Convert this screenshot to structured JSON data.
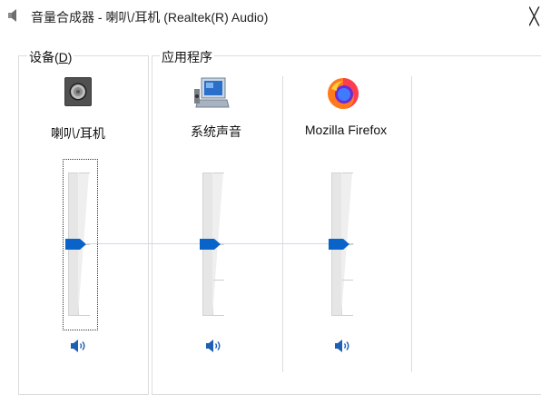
{
  "window": {
    "title": "音量合成器 - 喇叭/耳机 (Realtek(R) Audio)",
    "close_glyph": "╳"
  },
  "device_group": {
    "label_prefix": "设备(",
    "label_access_key": "D",
    "label_suffix": ")",
    "device_name": "喇叭/耳机",
    "volume_percent": 50,
    "muted": false
  },
  "apps_group": {
    "label": "应用程序",
    "apps": [
      {
        "name": "系统声音",
        "icon": "system-sounds-icon",
        "volume_percent": 50,
        "muted": false
      },
      {
        "name": "Mozilla Firefox",
        "icon": "firefox-icon",
        "volume_percent": 50,
        "muted": false
      }
    ]
  },
  "colors": {
    "accent": "#0a63c9",
    "track": "#e6e6e6",
    "group_border": "#dcdcdc"
  }
}
